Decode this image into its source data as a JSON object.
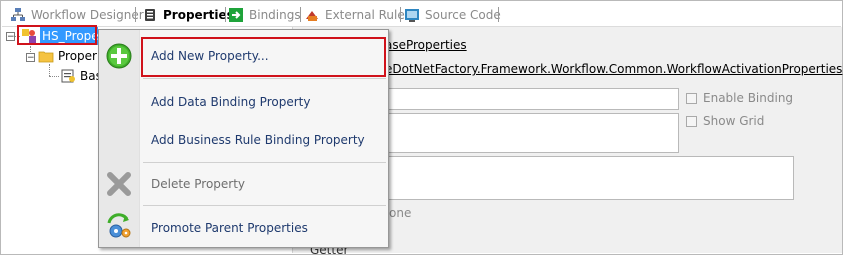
{
  "tabs": [
    {
      "label": "Workflow Designer",
      "icon": "workflow-designer-icon",
      "active": false
    },
    {
      "label": "Properties",
      "icon": "properties-icon",
      "active": true
    },
    {
      "label": "Bindings",
      "icon": "bindings-icon",
      "active": false
    },
    {
      "label": "External Rules",
      "icon": "external-rules-icon",
      "active": false
    },
    {
      "label": "Source Code",
      "icon": "source-code-icon",
      "active": false
    }
  ],
  "tree": {
    "root": {
      "label": "HS_PropertiesWF",
      "expanded": true
    },
    "child": {
      "label": "Proper",
      "expanded": true
    },
    "grandchild": {
      "label": "Bas"
    }
  },
  "properties_panel": {
    "base_link": "aseProperties",
    "class_link": "eDotNetFactory.Framework.Workflow.Common.WorkflowActivationProperties",
    "enable_binding_label": "Enable Binding",
    "show_grid_label": "Show Grid",
    "none_text": "one",
    "getter_label": "Getter"
  },
  "context_menu": {
    "items": [
      {
        "label": "Add New Property...",
        "icon": "add-green-icon",
        "enabled": true
      },
      {
        "label": "Add Data Binding Property",
        "icon": "",
        "enabled": true
      },
      {
        "label": "Add Business Rule Binding Property",
        "icon": "",
        "enabled": true
      },
      {
        "label": "Delete Property",
        "icon": "delete-x-icon",
        "enabled": false
      },
      {
        "label": "Promote Parent Properties",
        "icon": "promote-gears-icon",
        "enabled": true
      }
    ]
  },
  "highlight_color": "#d0121b",
  "selection_color": "#3399ff"
}
